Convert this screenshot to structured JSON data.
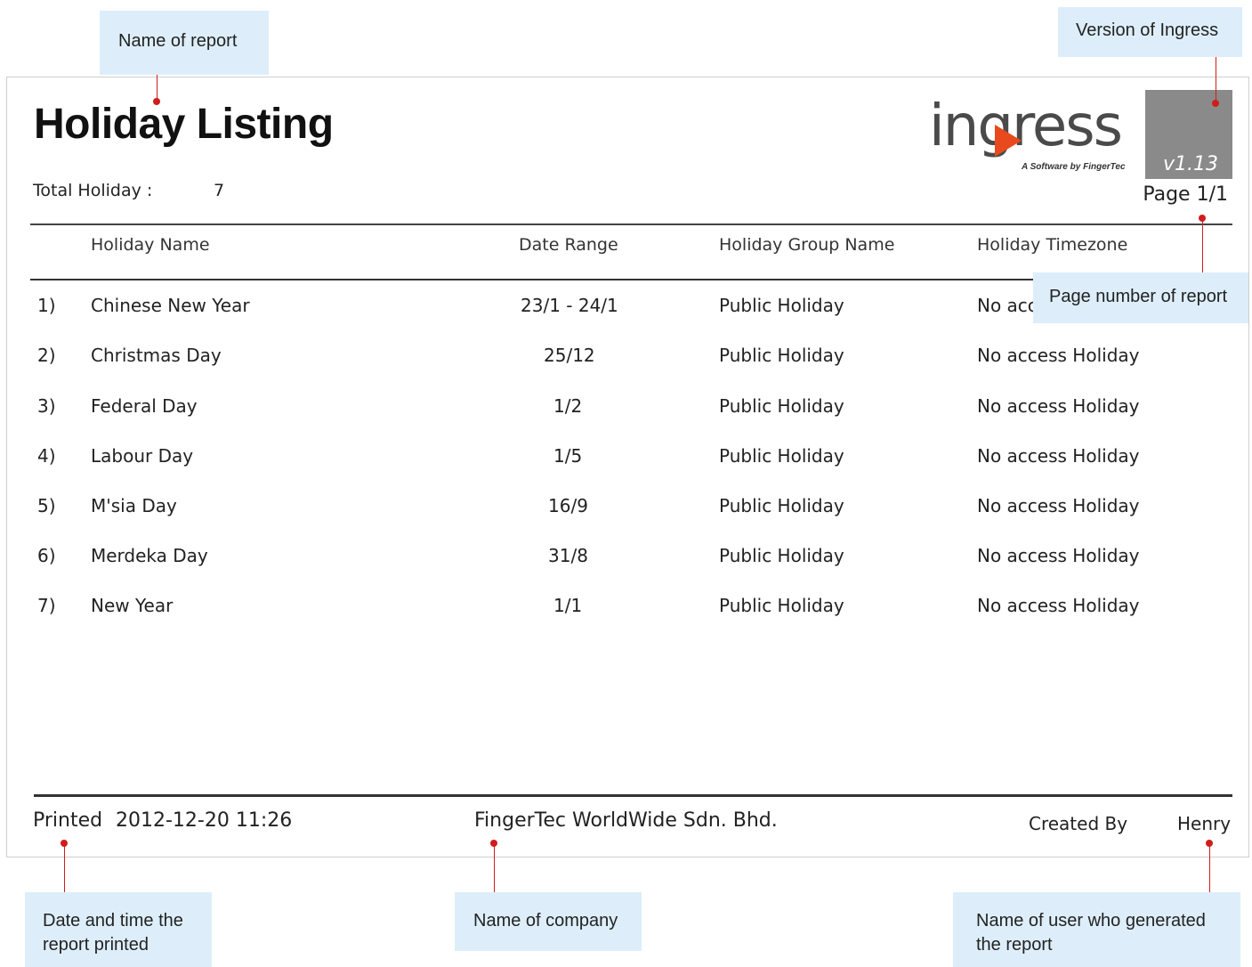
{
  "report": {
    "title": "Holiday Listing",
    "total_label": "Total Holiday :",
    "total_value": "7",
    "page": "Page 1/1"
  },
  "logo": {
    "word": "ingress",
    "tagline": "A Software by FingerTec",
    "version": "v1.13",
    "accent": "#e8491d"
  },
  "table": {
    "columns": [
      "Holiday Name",
      "Date Range",
      "Holiday Group Name",
      "Holiday Timezone"
    ],
    "rows": [
      {
        "no": "1)",
        "name": "Chinese New Year",
        "range": "23/1 - 24/1",
        "group": "Public Holiday",
        "timezone": "No access Holiday"
      },
      {
        "no": "2)",
        "name": "Christmas Day",
        "range": "25/12",
        "group": "Public Holiday",
        "timezone": "No access Holiday"
      },
      {
        "no": "3)",
        "name": "Federal Day",
        "range": "1/2",
        "group": "Public Holiday",
        "timezone": "No access Holiday"
      },
      {
        "no": "4)",
        "name": "Labour Day",
        "range": "1/5",
        "group": "Public Holiday",
        "timezone": "No access Holiday"
      },
      {
        "no": "5)",
        "name": "M'sia Day",
        "range": "16/9",
        "group": "Public Holiday",
        "timezone": "No access Holiday"
      },
      {
        "no": "6)",
        "name": "Merdeka Day",
        "range": "31/8",
        "group": "Public Holiday",
        "timezone": "No access Holiday"
      },
      {
        "no": "7)",
        "name": "New Year",
        "range": "1/1",
        "group": "Public Holiday",
        "timezone": "No access Holiday"
      }
    ]
  },
  "footer": {
    "printed_label": "Printed",
    "printed_value": "2012-12-20 11:26",
    "company": "FingerTec WorldWide Sdn. Bhd.",
    "created_label": "Created By",
    "created_value": "Henry"
  },
  "callouts": {
    "report_name": "Name of report",
    "version": "Version of Ingress",
    "page_number": "Page number of report",
    "printed": "Date and time the report printed",
    "company": "Name of company",
    "user": "Name of user who generated the report"
  },
  "colors": {
    "callout_bg": "#ddeefa",
    "leader": "#d11c1c"
  }
}
